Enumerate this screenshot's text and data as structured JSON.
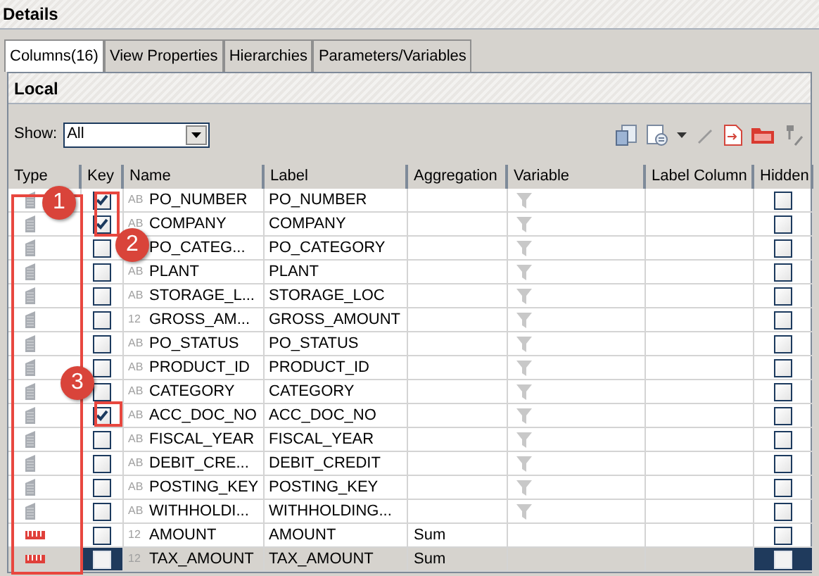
{
  "panel_title": "Details",
  "tabs": [
    {
      "label": "Columns(16)",
      "selected": true
    },
    {
      "label": "View Properties",
      "selected": false
    },
    {
      "label": "Hierarchies",
      "selected": false
    },
    {
      "label": "Parameters/Variables",
      "selected": false
    }
  ],
  "section_title": "Local",
  "show": {
    "label": "Show:",
    "value": "All"
  },
  "table": {
    "columns": [
      "Type",
      "Key",
      "Name",
      "Label",
      "Aggregation",
      "Variable",
      "Label Column",
      "Hidden"
    ],
    "rows": [
      {
        "kind": "attribute",
        "key": true,
        "datatype": "AB",
        "name": "PO_NUMBER",
        "label": "PO_NUMBER",
        "variable": true,
        "hidden": false,
        "selected": false
      },
      {
        "kind": "attribute",
        "key": true,
        "datatype": "AB",
        "name": "COMPANY",
        "label": "COMPANY",
        "variable": true,
        "hidden": false,
        "selected": false
      },
      {
        "kind": "attribute",
        "key": false,
        "name": "PO_CATEG...",
        "label": "PO_CATEGORY",
        "variable": true,
        "hidden": false,
        "selected": false
      },
      {
        "kind": "attribute",
        "key": false,
        "datatype": "AB",
        "name": "PLANT",
        "label": "PLANT",
        "variable": true,
        "hidden": false,
        "selected": false
      },
      {
        "kind": "attribute",
        "key": false,
        "datatype": "AB",
        "name": "STORAGE_L...",
        "label": "STORAGE_LOC",
        "variable": true,
        "hidden": false,
        "selected": false
      },
      {
        "kind": "attribute",
        "key": false,
        "datatype": "12",
        "name": "GROSS_AM...",
        "label": "GROSS_AMOUNT",
        "variable": true,
        "hidden": false,
        "selected": false
      },
      {
        "kind": "attribute",
        "key": false,
        "datatype": "AB",
        "name": "PO_STATUS",
        "label": "PO_STATUS",
        "variable": true,
        "hidden": false,
        "selected": false
      },
      {
        "kind": "attribute",
        "key": false,
        "datatype": "AB",
        "name": "PRODUCT_ID",
        "label": "PRODUCT_ID",
        "variable": true,
        "hidden": false,
        "selected": false
      },
      {
        "kind": "attribute",
        "key": false,
        "datatype": "AB",
        "name": "CATEGORY",
        "label": "CATEGORY",
        "variable": true,
        "hidden": false,
        "selected": false
      },
      {
        "kind": "attribute",
        "key": true,
        "datatype": "AB",
        "name": "ACC_DOC_NO",
        "label": "ACC_DOC_NO",
        "variable": true,
        "hidden": false,
        "selected": false
      },
      {
        "kind": "attribute",
        "key": false,
        "datatype": "AB",
        "name": "FISCAL_YEAR",
        "label": "FISCAL_YEAR",
        "variable": true,
        "hidden": false,
        "selected": false
      },
      {
        "kind": "attribute",
        "key": false,
        "datatype": "AB",
        "name": "DEBIT_CRE...",
        "label": "DEBIT_CREDIT",
        "variable": true,
        "hidden": false,
        "selected": false
      },
      {
        "kind": "attribute",
        "key": false,
        "datatype": "AB",
        "name": "POSTING_KEY",
        "label": "POSTING_KEY",
        "variable": true,
        "hidden": false,
        "selected": false
      },
      {
        "kind": "attribute",
        "key": false,
        "datatype": "AB",
        "name": "WITHHOLDI...",
        "label": "WITHHOLDING...",
        "variable": true,
        "hidden": false,
        "selected": false
      },
      {
        "kind": "measure",
        "key": false,
        "datatype": "12",
        "name": "AMOUNT",
        "label": "AMOUNT",
        "aggregation": "Sum",
        "variable": false,
        "hidden": false,
        "selected": false
      },
      {
        "kind": "measure",
        "key": false,
        "datatype": "12",
        "name": "TAX_AMOUNT",
        "label": "TAX_AMOUNT",
        "aggregation": "Sum",
        "variable": false,
        "hidden": false,
        "selected": true
      }
    ]
  },
  "annotations": [
    {
      "label": "1"
    },
    {
      "label": "2"
    },
    {
      "label": "3"
    }
  ]
}
